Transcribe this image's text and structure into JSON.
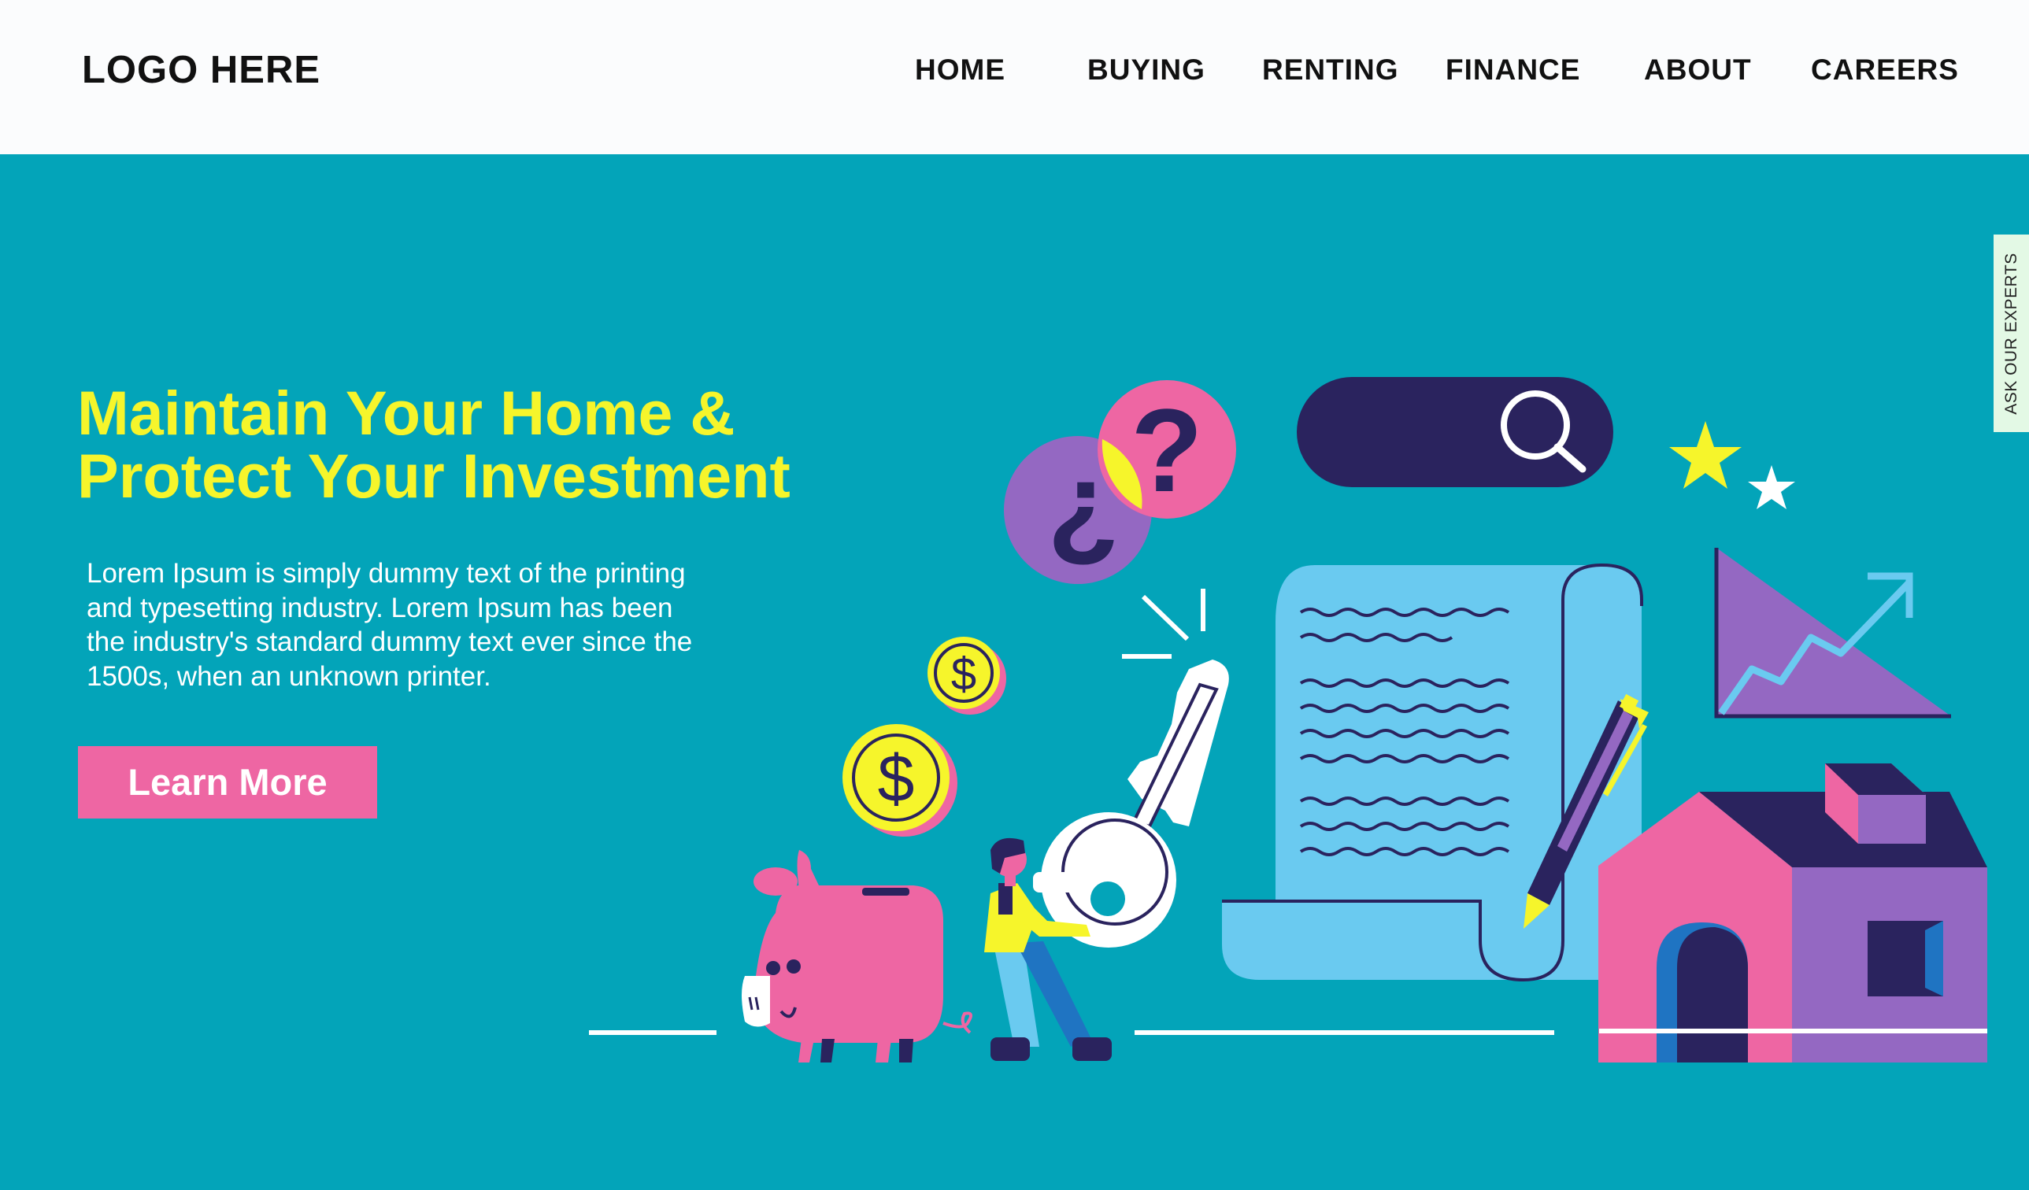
{
  "header": {
    "logo": "LOGO HERE",
    "nav": [
      {
        "label": "HOME"
      },
      {
        "label": "BUYING"
      },
      {
        "label": "RENTING"
      },
      {
        "label": "FINANCE"
      },
      {
        "label": "ABOUT"
      },
      {
        "label": "CAREERS"
      }
    ]
  },
  "hero": {
    "title_lines": [
      "Maintain Your Home &",
      "Protect Your Investment"
    ],
    "body_lines": [
      "Lorem Ipsum is simply dummy text of the printing",
      "and typesetting industry. Lorem Ipsum has been",
      "the industry's standard dummy text ever since the",
      "1500s, when an unknown printer."
    ],
    "cta_label": "Learn More"
  },
  "side_tab": {
    "label": "ASK OUR EXPERTS"
  },
  "illustration": {
    "question_marks": [
      "¿",
      "?"
    ],
    "coin_symbol": "$"
  },
  "colors": {
    "background": "#03a4b9",
    "header": "#fbfcfd",
    "accent_yellow": "#f6f52b",
    "accent_pink": "#ee66a3",
    "navy": "#2a235e",
    "purple": "#9468c2",
    "light_blue": "#6acaf0"
  }
}
